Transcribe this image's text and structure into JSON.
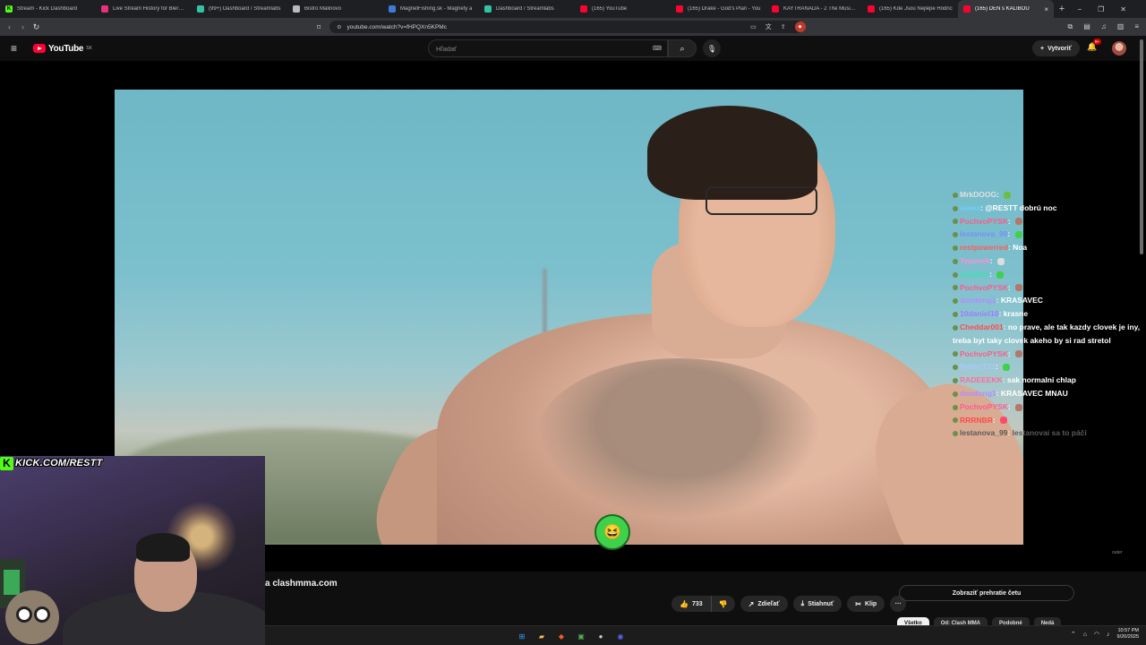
{
  "browser": {
    "tabs": [
      {
        "label": "Stream - Kick Dashboard",
        "color": "#53fc18",
        "glyph": "K"
      },
      {
        "label": "Live Stream History for Blerp S",
        "color": "#e8317a",
        "glyph": ""
      },
      {
        "label": "(99+) Dashboard / Streamlabs",
        "color": "#31c3a2",
        "glyph": ""
      },
      {
        "label": "Bistro Malinovo",
        "color": "#bbbbbb",
        "glyph": ""
      },
      {
        "label": "MagnetFishing.sk - Magnety a",
        "color": "#3d7bd9",
        "glyph": ""
      },
      {
        "label": "Dashboard / Streamlabs",
        "color": "#31c3a2",
        "glyph": ""
      },
      {
        "label": "(165) YouTube",
        "color": "#ff0033",
        "glyph": ""
      },
      {
        "label": "(165) Drake - God's Plan - You",
        "color": "#ff0033",
        "glyph": ""
      },
      {
        "label": "KAYTRANADA - 2 The Music D",
        "color": "#ff0033",
        "glyph": ""
      },
      {
        "label": "(165) Kde Jsou Nejlépe Hodnc",
        "color": "#ff0033",
        "glyph": ""
      },
      {
        "label": "(165) DEN s KALIBOU",
        "color": "#ff0033",
        "glyph": "",
        "active": true
      }
    ],
    "url": "youtube.com/watch?v=fHPQXn5KPMc",
    "new_tab": "+",
    "window_controls": [
      "−",
      "❐",
      "✕"
    ]
  },
  "youtube": {
    "logo_text": "YouTube",
    "region": "SK",
    "search_placeholder": "Hľadať",
    "create_label": "Vytvoriť",
    "notifications": "9+",
    "video_title": "a clashmma.com",
    "likes": "733",
    "share_label": "Zdieľať",
    "download_label": "Stiahnuť",
    "clip_label": "Klip",
    "chat_replay_label": "Zobraziť prehratie četu",
    "chips": [
      "Všetko",
      "Od: Clash MMA",
      "Podobné",
      "Nedá"
    ],
    "channel_watermark": "outer"
  },
  "stream": {
    "kick_url": "KICK.COM/RESTT",
    "chat": [
      {
        "user": "MrkDOOG",
        "color": "#e0e0e0",
        "text": "",
        "emote": "#6bbf3f"
      },
      {
        "user": "viwex",
        "color": "#6ad0ff",
        "text": "@RESTT dobrú noc",
        "emote": ""
      },
      {
        "user": "PochvoPYSK",
        "color": "#ff5a8c",
        "text": "",
        "emote": "#b3786b"
      },
      {
        "user": "lestanova_99",
        "color": "#7a8cff",
        "text": "",
        "emote": "#3fd14b"
      },
      {
        "user": "restpowerred",
        "color": "#ff5a5a",
        "text": "Noa",
        "emote": ""
      },
      {
        "user": "Typosek",
        "color": "#ff8fd4",
        "text": "",
        "emote": "#dddddd"
      },
      {
        "user": "aniaktor",
        "color": "#3fe0b0",
        "text": "",
        "emote": "#3fd14b"
      },
      {
        "user": "PochvoPYSK",
        "color": "#ff5a8c",
        "text": "",
        "emote": "#b3786b"
      },
      {
        "user": "dendong1",
        "color": "#b08cff",
        "text": "KRASAVEC",
        "emote": ""
      },
      {
        "user": "10daniel10",
        "color": "#9b7bff",
        "text": "krasne",
        "emote": ""
      },
      {
        "user": "Cheddar001",
        "color": "#ff4a4a",
        "text": "no prave, ale tak kazdy clovek je iny, treba byt taky clovek akeho by si rad stretol",
        "emote": ""
      },
      {
        "user": "PochvoPYSK",
        "color": "#ff5a8c",
        "text": "",
        "emote": "#b3786b"
      },
      {
        "user": "PatienT21",
        "color": "#a8c8ff",
        "text": "",
        "emote": "#3fd14b"
      },
      {
        "user": "RADEEEKK",
        "color": "#ff6b9c",
        "text": "sak normalni chlap",
        "emote": ""
      },
      {
        "user": "dendong1",
        "color": "#b08cff",
        "text": "KRASAVEC MNAU",
        "emote": ""
      },
      {
        "user": "PochvoPYSK",
        "color": "#ff5a8c",
        "text": "",
        "emote": "#b3786b"
      },
      {
        "user": "RRRNBR",
        "color": "#ff4a4a",
        "text": "",
        "emote": "#ff4a6a"
      },
      {
        "user": "lestanova_99",
        "color": "#5a5a5a",
        "text": "lestanovai sa to páčí",
        "emote": ""
      }
    ]
  },
  "taskbar": {
    "time": "10:57 PM",
    "date": "9/20/2025",
    "apps": [
      {
        "name": "windows-start-icon",
        "glyph": "⊞",
        "color": "#3aa0ff"
      },
      {
        "name": "file-explorer-icon",
        "glyph": "▰",
        "color": "#f2c14e"
      },
      {
        "name": "brave-icon",
        "glyph": "◆",
        "color": "#fb542b"
      },
      {
        "name": "terminal-icon",
        "glyph": "▣",
        "color": "#4caf50"
      },
      {
        "name": "obs-icon",
        "glyph": "●",
        "color": "#cccccc"
      },
      {
        "name": "discord-icon",
        "glyph": "◉",
        "color": "#5865f2"
      }
    ]
  }
}
